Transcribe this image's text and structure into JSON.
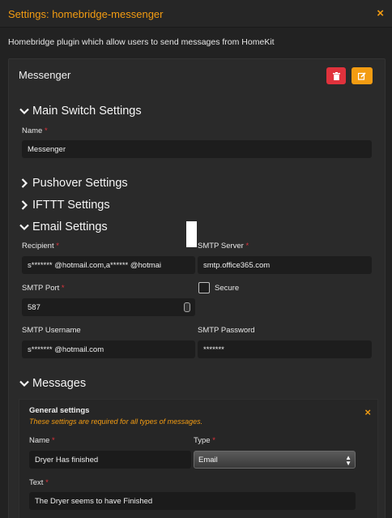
{
  "header": {
    "title": "Settings: homebridge-messenger",
    "close": "×"
  },
  "description": "Homebridge plugin which allow users to send messages from HomeKit",
  "card": {
    "title": "Messenger"
  },
  "sections": {
    "main_switch": "Main Switch Settings",
    "pushover": "Pushover Settings",
    "ifttt": "IFTTT Settings",
    "email": "Email Settings",
    "messages": "Messages"
  },
  "main": {
    "name_label": "Name",
    "name_value": "Messenger"
  },
  "email": {
    "recipient_label": "Recipient",
    "recipient_value": "s******* @hotmail.com,a****** @hotmai",
    "smtp_server_label": "SMTP Server",
    "smtp_server_value": "smtp.office365.com",
    "smtp_port_label": "SMTP Port",
    "smtp_port_value": "587",
    "secure_label": "Secure",
    "smtp_username_label": "SMTP Username",
    "smtp_username_value": "s******* @hotmail.com",
    "smtp_password_label": "SMTP Password",
    "smtp_password_value": "*******"
  },
  "messages": {
    "general_title": "General settings",
    "general_note": "These settings are required for all types of messages.",
    "name_label": "Name",
    "name_value": "Dryer Has finished",
    "type_label": "Type",
    "type_value": "Email",
    "text_label": "Text",
    "text_value": "The Dryer seems to have Finished"
  },
  "colors": {
    "accent": "#f39c12",
    "danger": "#e0323c"
  }
}
